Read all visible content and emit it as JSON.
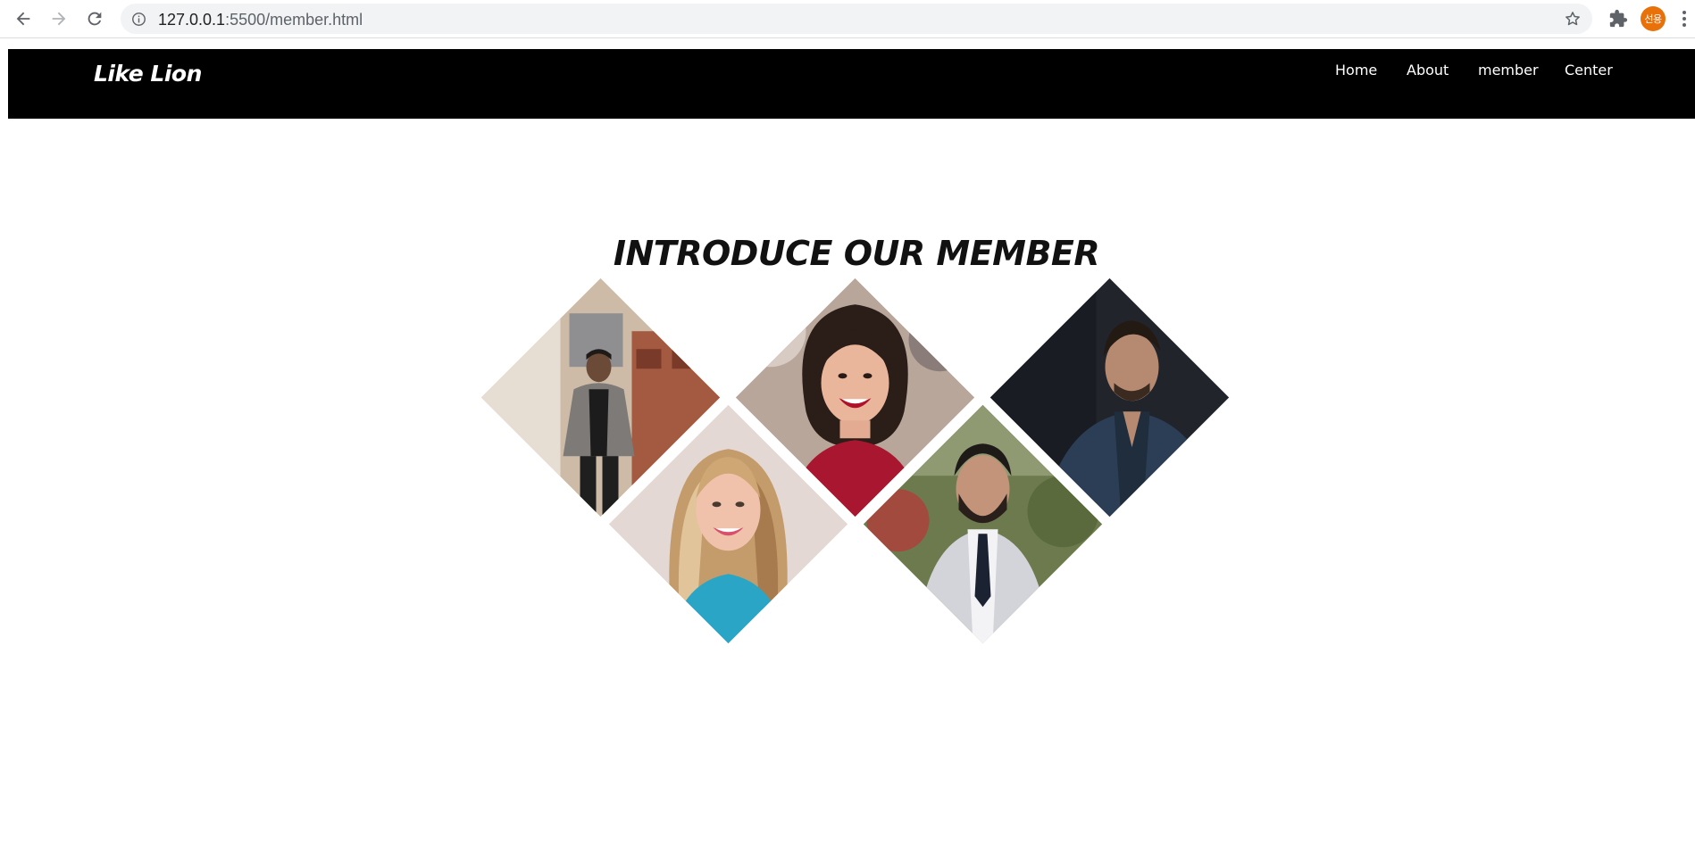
{
  "browser": {
    "url_host": "127.0.0.1",
    "url_path": ":5500/member.html",
    "profile_initials": "선용",
    "icons": [
      "back-arrow-icon",
      "forward-arrow-icon",
      "reload-icon",
      "info-icon",
      "star-icon",
      "puzzle-icon",
      "kebab-menu-icon"
    ]
  },
  "site": {
    "brand": "Like Lion",
    "nav": [
      "Home",
      "About",
      "member",
      "Center"
    ]
  },
  "main": {
    "title": "INTRODUCE OUR MEMBER",
    "members": [
      {
        "description": "man in grey blazer standing in alley",
        "bg": "#c9b9a7",
        "accent": "#2a2a2a"
      },
      {
        "description": "smiling woman with dark hair in red top",
        "bg": "#b6a59b",
        "accent": "#9b1b2a"
      },
      {
        "description": "man in dark navy blazer",
        "bg": "#23262f",
        "accent": "#2d4257"
      },
      {
        "description": "smiling blonde woman in turquoise top",
        "bg": "#e7dcd8",
        "accent": "#2aa3c4"
      },
      {
        "description": "bearded man in light grey suit and tie",
        "bg": "#6e7b4f",
        "accent": "#cfd0d6"
      }
    ]
  }
}
